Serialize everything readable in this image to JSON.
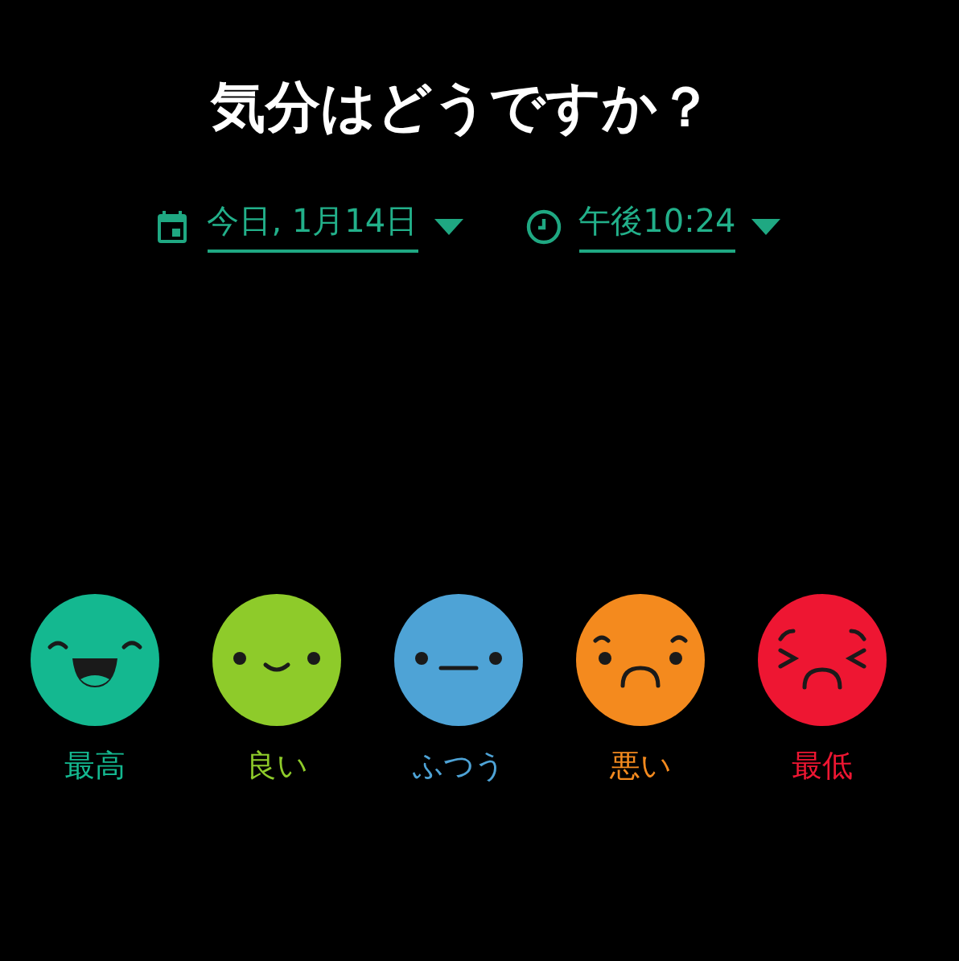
{
  "title": "気分はどうですか？",
  "date": {
    "value": "今日, 1月14日"
  },
  "time": {
    "value": "午後10:24"
  },
  "moods": [
    {
      "label": "最高",
      "kind": "laugh",
      "color": "#14b890"
    },
    {
      "label": "良い",
      "kind": "smile",
      "color": "#8ecb2a"
    },
    {
      "label": "ふつう",
      "kind": "neutral",
      "color": "#4ea3d6"
    },
    {
      "label": "悪い",
      "kind": "sad",
      "color": "#f48a1e"
    },
    {
      "label": "最低",
      "kind": "angry",
      "color": "#ee1632"
    }
  ]
}
